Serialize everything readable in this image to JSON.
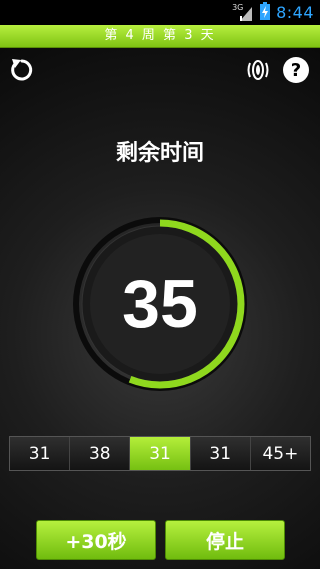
{
  "status_bar": {
    "time": "8:44",
    "network_label": "3G"
  },
  "title_bar": {
    "title": "第 4 周 第 3 天"
  },
  "toolbar": {
    "reset_icon": "refresh-icon",
    "sound_icon": "vibrate-icon",
    "help_icon": "help-icon"
  },
  "timer": {
    "label": "剩余时间",
    "value": "35",
    "progress": 0.56,
    "accent": "#8fd81e"
  },
  "selector": {
    "items": [
      {
        "label": "31"
      },
      {
        "label": "38"
      },
      {
        "label": "31"
      },
      {
        "label": "31"
      },
      {
        "label": "45+"
      }
    ],
    "active_index": 2
  },
  "actions": {
    "add_label": "+30秒",
    "stop_label": "停止"
  }
}
